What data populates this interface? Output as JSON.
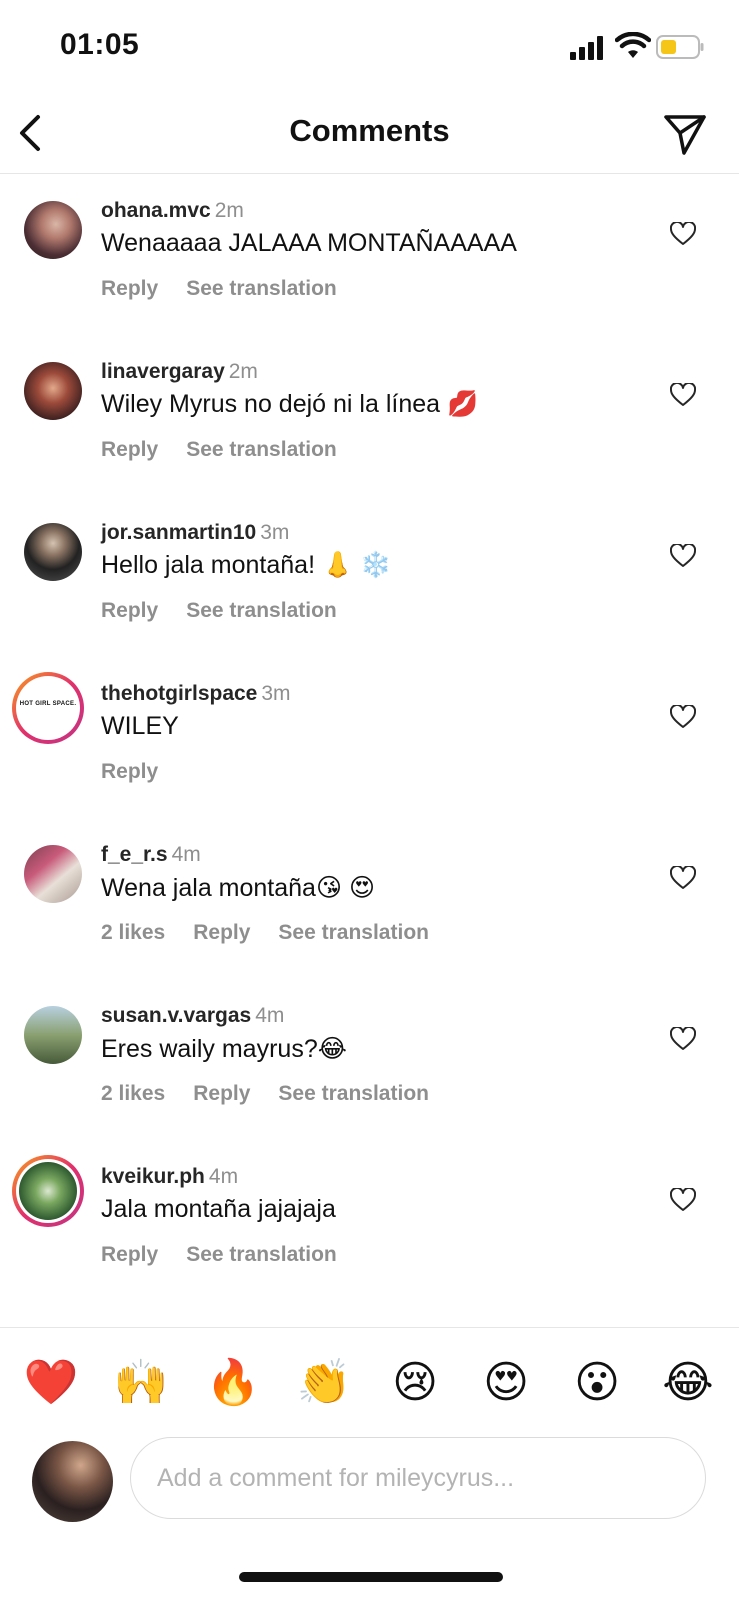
{
  "status_bar": {
    "time": "01:05"
  },
  "header": {
    "title": "Comments"
  },
  "comments": [
    {
      "user": "ohana.mvc",
      "ago": "2m",
      "text": "Wenaaaaa JALAAA MONTAÑAAAAA",
      "likes": "",
      "reply": "Reply",
      "translate": "See translation"
    },
    {
      "user": "linavergaray",
      "ago": "2m",
      "text": "Wiley Myrus no dejó ni la línea 💋",
      "likes": "",
      "reply": "Reply",
      "translate": "See translation"
    },
    {
      "user": "jor.sanmartin10",
      "ago": "3m",
      "text": "Hello jala montaña! 👃 ❄️",
      "likes": "",
      "reply": "Reply",
      "translate": "See translation"
    },
    {
      "user": "thehotgirlspace",
      "ago": "3m",
      "text": "WILEY",
      "likes": "",
      "reply": "Reply",
      "translate": "",
      "avatar_text": "HOT GIRL SPACE."
    },
    {
      "user": "f_e_r.s",
      "ago": "4m",
      "text": "Wena jala montaña😘 😍",
      "likes": "2 likes",
      "reply": "Reply",
      "translate": "See translation"
    },
    {
      "user": "susan.v.vargas",
      "ago": "4m",
      "text": "Eres waily mayrus?😂",
      "likes": "2 likes",
      "reply": "Reply",
      "translate": "See translation"
    },
    {
      "user": "kveikur.ph",
      "ago": "4m",
      "text": "Jala montaña jajajaja",
      "likes": "",
      "reply": "Reply",
      "translate": "See translation"
    }
  ],
  "emoji_bar": [
    "❤️",
    "🙌",
    "🔥",
    "👏",
    "😢",
    "😍",
    "😮",
    "😂"
  ],
  "composer": {
    "placeholder": "Add a comment for mileycyrus..."
  },
  "icons": {
    "back": "chevron-left-icon",
    "send": "paper-plane-icon",
    "like": "heart-outline-icon"
  },
  "colors": {
    "muted": "#8e8e8e",
    "divider": "#e6e6e6",
    "battery": "#f5c518",
    "story_ring_start": "#f9a01b",
    "story_ring_end": "#c13584"
  }
}
